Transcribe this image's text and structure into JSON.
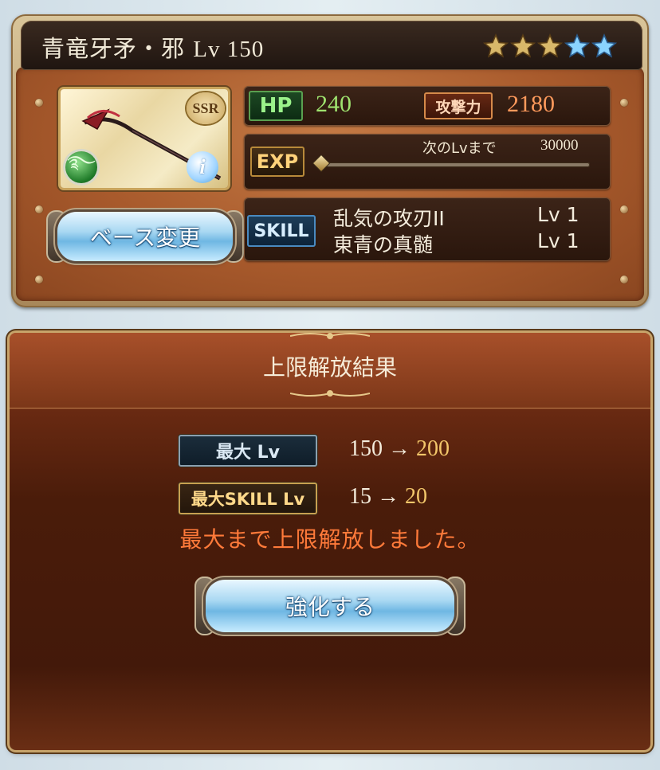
{
  "weapon": {
    "name": "青竜牙矛・邪",
    "level_label": "Lv 150",
    "rarity": "SSR",
    "stars_total": 5,
    "stars_filled": 3,
    "hp_label": "HP",
    "hp_value": "240",
    "atk_label": "攻撃力",
    "atk_value": "2180",
    "exp_label": "EXP",
    "next_lv_label": "次のLvまで",
    "next_lv_value": "30000",
    "exp_progress": 0,
    "skill_label": "SKILL",
    "skills": [
      {
        "name": "乱気の攻刃II",
        "level": "Lv 1"
      },
      {
        "name": "東青の真髄",
        "level": "Lv 1"
      }
    ],
    "base_change_label": "ベース変更"
  },
  "result": {
    "title": "上限解放結果",
    "max_lv_label": "最大 Lv",
    "max_lv_old": "150",
    "max_lv_new": "200",
    "max_skill_label": "最大SKILL Lv",
    "max_skill_old": "15",
    "max_skill_new": "20",
    "arrow": "→",
    "notice": "最大まで上限解放しました。",
    "enhance_label": "強化する"
  },
  "colors": {
    "hp": "#9fe36f",
    "atk": "#ff9a5c",
    "notice": "#ff7a3a",
    "new_value": "#f2c66a",
    "star_gold": "#d8b86a",
    "star_blue": "#8ad4ff"
  },
  "icons": {
    "element": "wind-element-icon",
    "info": "info-icon"
  }
}
